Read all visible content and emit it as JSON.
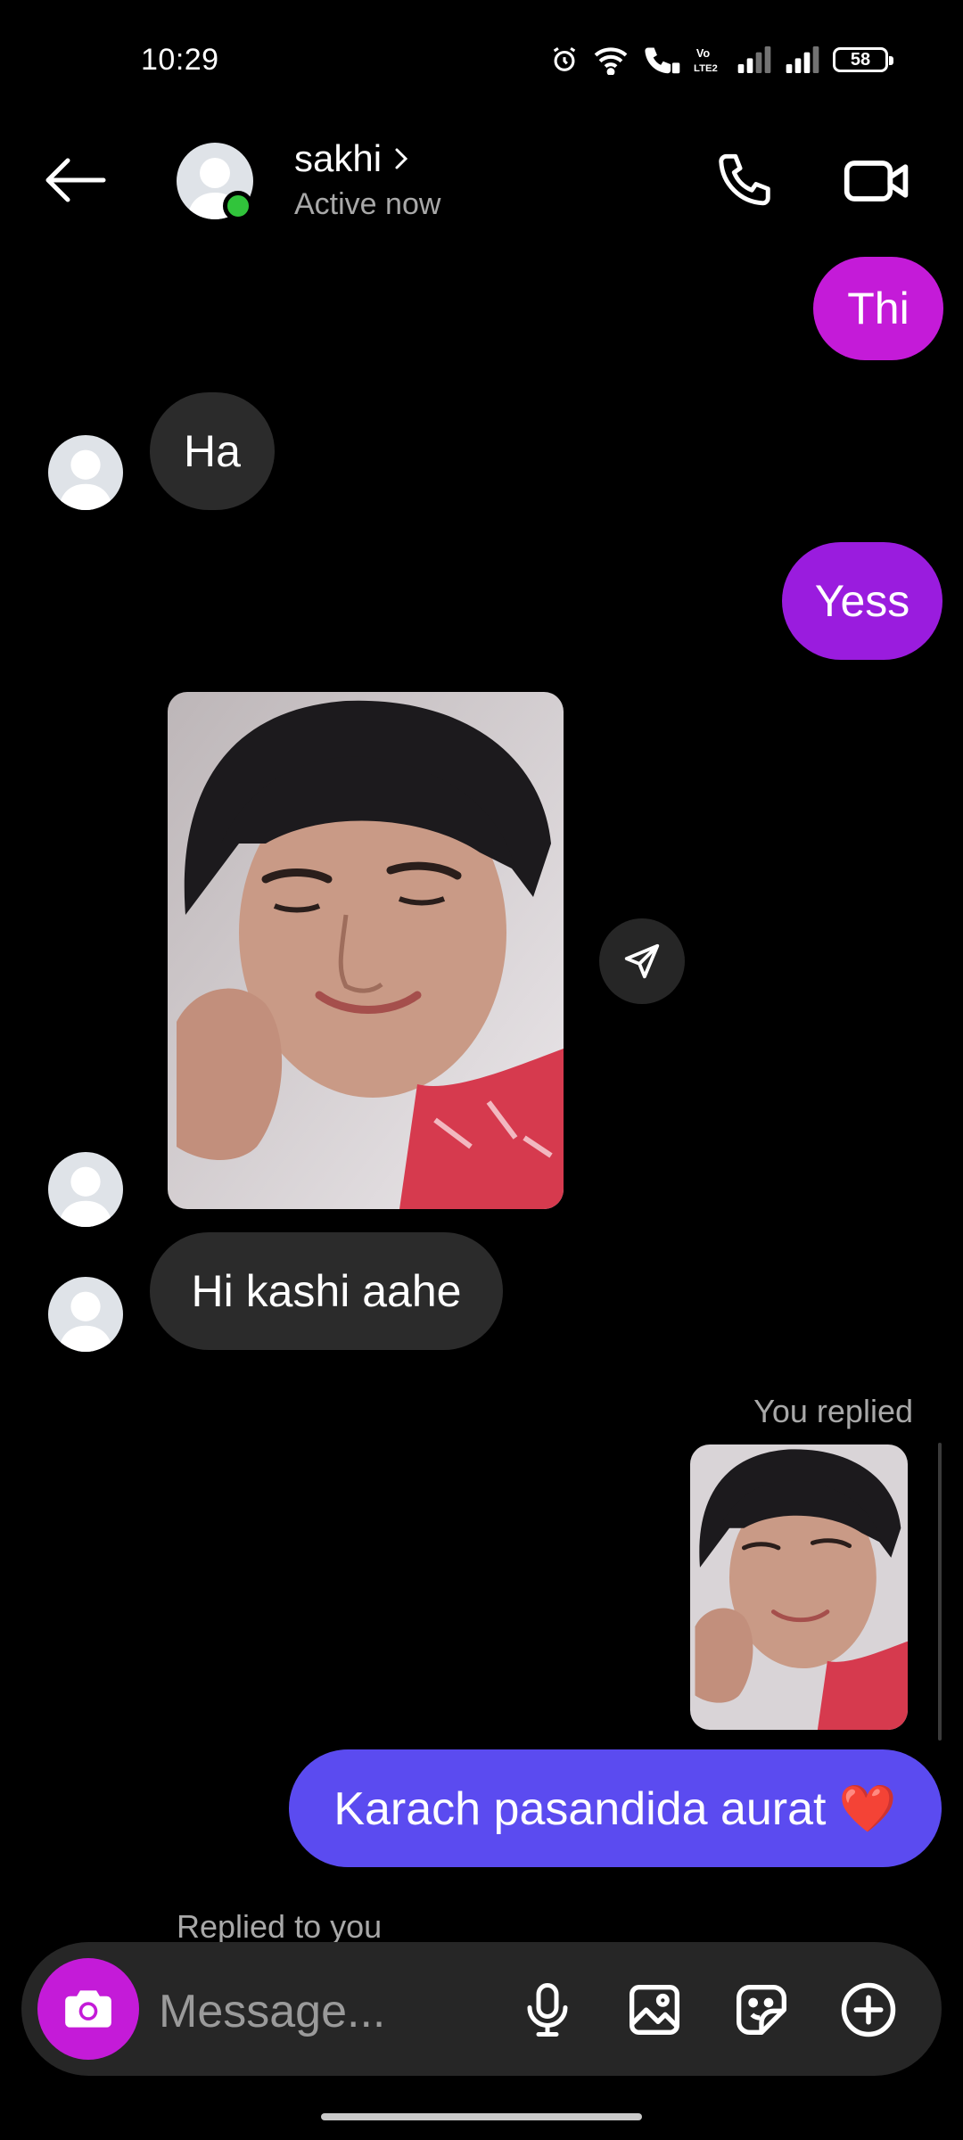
{
  "status_bar": {
    "time": "10:29",
    "battery": "58"
  },
  "header": {
    "name": "sakhi",
    "status": "Active now"
  },
  "messages": {
    "thi": "Thi",
    "ha": "Ha",
    "yess": "Yess",
    "hi": "Hi kashi aahe",
    "you_replied": "You replied",
    "karach": "Karach pasandida aurat ❤️",
    "replied_to_you": "Replied to you"
  },
  "composer": {
    "placeholder": "Message..."
  },
  "colors": {
    "sent_magenta": "#c41bd8",
    "sent_purple": "#9a1cde",
    "sent_indigo": "#5b4bf0",
    "received": "#2b2b2b",
    "online": "#31c43b"
  },
  "icons": [
    "back-arrow-icon",
    "chevron-right-icon",
    "phone-icon",
    "video-camera-icon",
    "send-icon",
    "camera-icon",
    "microphone-icon",
    "gallery-icon",
    "sticker-icon",
    "plus-circle-icon"
  ]
}
